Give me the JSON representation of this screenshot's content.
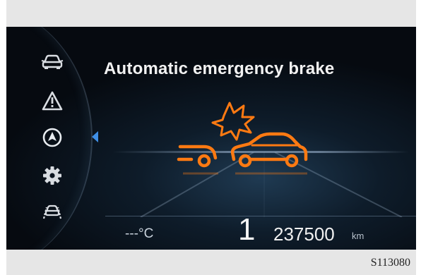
{
  "display": {
    "title": "Automatic emergency brake",
    "outside_temp": "---°C",
    "gear": "1",
    "odometer_value": "237500",
    "odometer_unit": "km"
  },
  "sidebar": {
    "icons": [
      "car-front-icon",
      "warning-triangle-icon",
      "navigation-icon",
      "settings-gear-icon",
      "driver-assist-icon"
    ],
    "selected_index": 2
  },
  "caption": {
    "figure_code": "S113080"
  },
  "colors": {
    "warning_orange": "#ff7a12",
    "selector_blue": "#3f8fe6",
    "text_white": "#f2f2f2"
  }
}
